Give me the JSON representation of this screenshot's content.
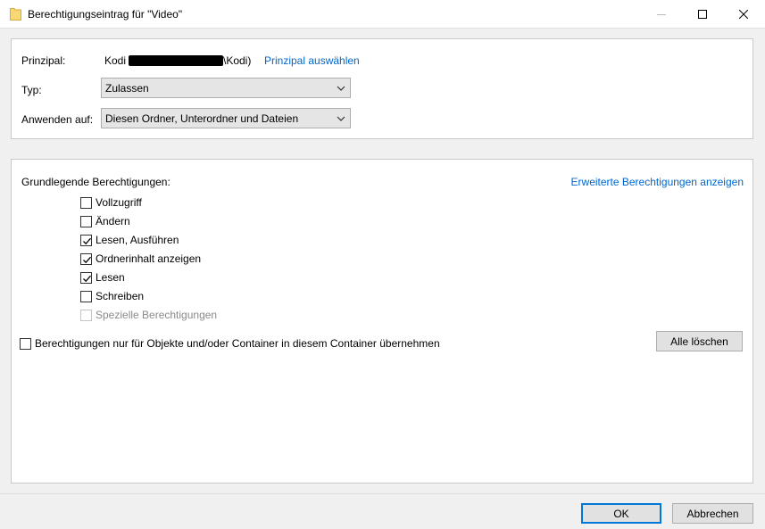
{
  "window": {
    "title": "Berechtigungseintrag für \"Video\"",
    "icon": "folder-icon"
  },
  "principal": {
    "label": "Prinzipal:",
    "name_prefix": "Kodi",
    "name_suffix": "\\Kodi)",
    "select_link": "Prinzipal auswählen"
  },
  "type": {
    "label": "Typ:",
    "value": "Zulassen"
  },
  "apply_to": {
    "label": "Anwenden auf:",
    "value": "Diesen Ordner, Unterordner und Dateien"
  },
  "permissions": {
    "heading": "Grundlegende Berechtigungen:",
    "advanced_link": "Erweiterte Berechtigungen anzeigen",
    "items": [
      {
        "label": "Vollzugriff",
        "checked": false,
        "disabled": false
      },
      {
        "label": "Ändern",
        "checked": false,
        "disabled": false
      },
      {
        "label": "Lesen, Ausführen",
        "checked": true,
        "disabled": false
      },
      {
        "label": "Ordnerinhalt anzeigen",
        "checked": true,
        "disabled": false
      },
      {
        "label": "Lesen",
        "checked": true,
        "disabled": false
      },
      {
        "label": "Schreiben",
        "checked": false,
        "disabled": false
      },
      {
        "label": "Spezielle Berechtigungen",
        "checked": false,
        "disabled": true
      }
    ],
    "inherit_label": "Berechtigungen nur für Objekte und/oder Container in diesem Container übernehmen",
    "inherit_checked": false,
    "clear_all": "Alle löschen"
  },
  "buttons": {
    "ok": "OK",
    "cancel": "Abbrechen"
  },
  "colors": {
    "link": "#0066cc",
    "accent": "#0078d7",
    "folder": "#f8d775"
  }
}
